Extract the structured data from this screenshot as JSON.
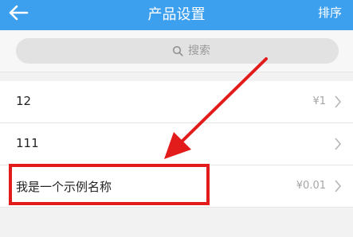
{
  "header": {
    "title": "产品设置",
    "sort_label": "排序",
    "back_icon": "arrow-left-icon"
  },
  "search": {
    "placeholder": "搜索",
    "icon": "search-icon"
  },
  "products": [
    {
      "name": "12",
      "price": "¥1"
    },
    {
      "name": "111",
      "price": ""
    },
    {
      "name": "我是一个示例名称",
      "price": "¥0.01"
    }
  ],
  "annotation": {
    "color": "#e21b1b"
  },
  "colors": {
    "header": "#3da0ef",
    "background": "#f2f2f2"
  }
}
